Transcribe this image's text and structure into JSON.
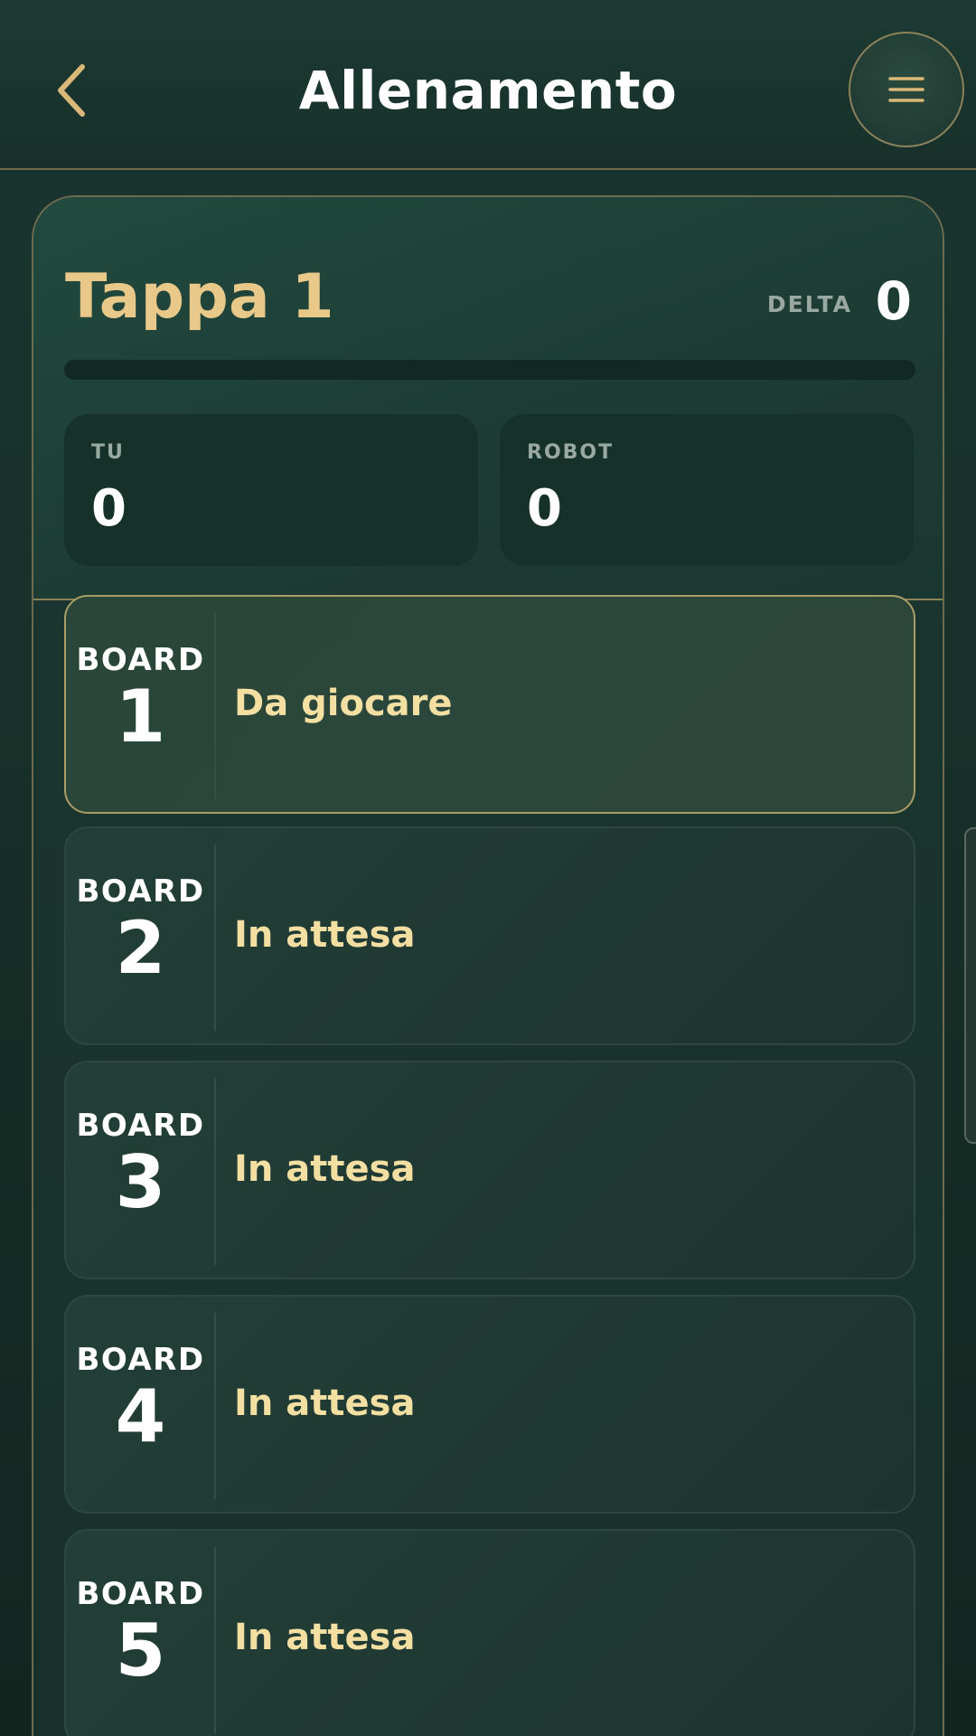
{
  "header": {
    "title": "Allenamento",
    "back_icon": "chevron-left-icon",
    "menu_icon": "hamburger-menu-icon"
  },
  "stage": {
    "title": "Tappa 1",
    "delta_label": "DELTA",
    "delta_value": "0",
    "progress": 0,
    "you": {
      "label": "TU",
      "value": "0"
    },
    "robot": {
      "label": "ROBOT",
      "value": "0"
    }
  },
  "boards": [
    {
      "word": "BOARD",
      "number": "1",
      "status": "Da giocare",
      "active": true
    },
    {
      "word": "BOARD",
      "number": "2",
      "status": "In attesa",
      "active": false
    },
    {
      "word": "BOARD",
      "number": "3",
      "status": "In attesa",
      "active": false
    },
    {
      "word": "BOARD",
      "number": "4",
      "status": "In attesa",
      "active": false
    },
    {
      "word": "BOARD",
      "number": "5",
      "status": "In attesa",
      "active": false
    }
  ],
  "colors": {
    "accent_gold": "#e9c98a",
    "status_text": "#f4dfa3",
    "background": "#17302a"
  }
}
